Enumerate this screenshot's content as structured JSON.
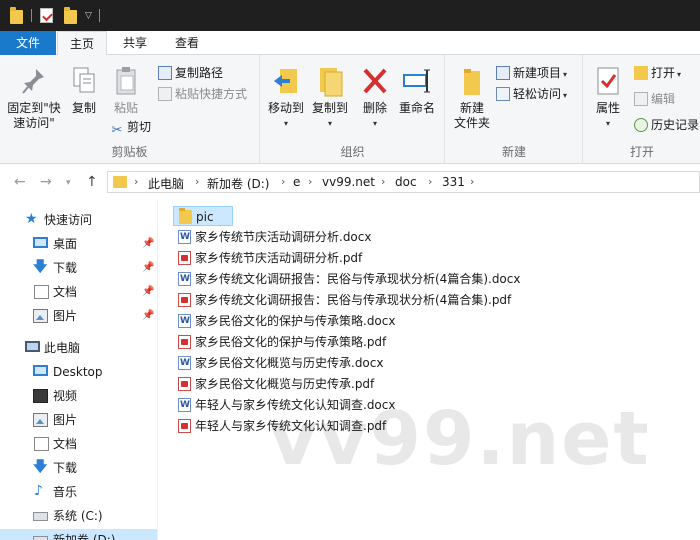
{
  "tabs": {
    "file": "文件",
    "home": "主页",
    "share": "共享",
    "view": "查看"
  },
  "ribbon": {
    "clipboard": {
      "label": "剪贴板",
      "pin_quick_access": "固定到\"快速访问\"",
      "copy": "复制",
      "paste": "粘贴",
      "copy_path": "复制路径",
      "paste_shortcut": "粘贴快捷方式",
      "cut": "剪切"
    },
    "organize": {
      "label": "组织",
      "move_to": "移动到",
      "copy_to": "复制到",
      "delete": "删除",
      "rename": "重命名"
    },
    "new": {
      "label": "新建",
      "new_folder": "新建\n文件夹",
      "new_item": "新建项目",
      "easy_access": "轻松访问"
    },
    "open": {
      "label": "打开",
      "properties": "属性",
      "open": "打开",
      "edit": "编辑",
      "history": "历史记录"
    }
  },
  "address": {
    "crumbs": [
      "此电脑",
      "新加卷 (D:)",
      "e",
      "vv99.net",
      "doc",
      "331"
    ]
  },
  "navpane": {
    "quick_access": "快速访问",
    "quick_items": [
      "桌面",
      "下载",
      "文档",
      "图片"
    ],
    "this_pc": "此电脑",
    "pc_items": [
      "Desktop",
      "视频",
      "图片",
      "文档",
      "下载",
      "音乐",
      "系统 (C:)",
      "新加卷 (D:)"
    ]
  },
  "files": [
    {
      "name": "pic",
      "type": "folder"
    },
    {
      "name": "家乡传统节庆活动调研分析.docx",
      "type": "docx"
    },
    {
      "name": "家乡传统节庆活动调研分析.pdf",
      "type": "pdf"
    },
    {
      "name": "家乡传统文化调研报告：民俗与传承现状分析(4篇合集).docx",
      "type": "docx"
    },
    {
      "name": "家乡传统文化调研报告：民俗与传承现状分析(4篇合集).pdf",
      "type": "pdf"
    },
    {
      "name": "家乡民俗文化的保护与传承策略.docx",
      "type": "docx"
    },
    {
      "name": "家乡民俗文化的保护与传承策略.pdf",
      "type": "pdf"
    },
    {
      "name": "家乡民俗文化概览与历史传承.docx",
      "type": "docx"
    },
    {
      "name": "家乡民俗文化概览与历史传承.pdf",
      "type": "pdf"
    },
    {
      "name": "年轻人与家乡传统文化认知调查.docx",
      "type": "docx"
    },
    {
      "name": "年轻人与家乡传统文化认知调查.pdf",
      "type": "pdf"
    }
  ],
  "watermark": "vv99.net",
  "colors": {
    "accent": "#1979ca",
    "selection": "#cce8ff",
    "folder": "#f3c94d",
    "pdf": "#d3302f",
    "docx": "#2b579a"
  }
}
